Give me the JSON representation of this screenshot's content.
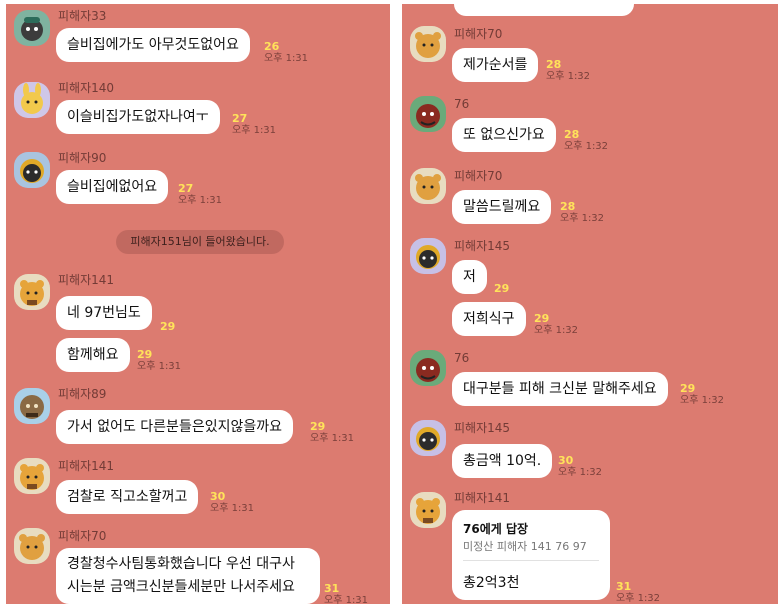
{
  "theme": {
    "chat_bg": "#dc7b70",
    "unread_color": "#ffe35a",
    "bubble_color": "#ffffff"
  },
  "left": {
    "messages": [
      {
        "sender": "피해자33",
        "avatar": "character-avatar-icon",
        "text": "슬비집에가도 아무것도없어요",
        "unread": "26",
        "time": "오후 1:31"
      },
      {
        "sender": "피해자140",
        "avatar": "character-avatar-icon",
        "text": "이슬비집가도없자나여ㅜ",
        "unread": "27",
        "time": "오후 1:31"
      },
      {
        "sender": "피해자90",
        "avatar": "character-avatar-icon",
        "text": "슬비집에없어요",
        "unread": "27",
        "time": "오후 1:31"
      },
      {
        "sender": "피해자141",
        "avatar": "character-avatar-icon",
        "text": "네 97번님도",
        "unread": "29",
        "time": ""
      },
      {
        "sender": "",
        "avatar": "",
        "text": "함께해요",
        "unread": "29",
        "time": "오후 1:31"
      },
      {
        "sender": "피해자89",
        "avatar": "character-avatar-icon",
        "text": "가서 없어도 다른분들은있지않을까요",
        "unread": "29",
        "time": "오후 1:31"
      },
      {
        "sender": "피해자141",
        "avatar": "character-avatar-icon",
        "text": "검찰로 직고소할꺼고",
        "unread": "30",
        "time": "오후 1:31"
      },
      {
        "sender": "피해자70",
        "avatar": "character-avatar-icon",
        "text_line1": "경찰청수사팀통화했습니다 우선 대구사",
        "text_line2": "시는분 금액크신분들세분만 나서주세요",
        "unread": "31",
        "time": "오후 1:31"
      }
    ],
    "system_notice": "피해자151님이 들어왔습니다."
  },
  "right": {
    "messages": [
      {
        "sender": "피해자70",
        "avatar": "character-avatar-icon",
        "text": "제가순서를",
        "unread": "28",
        "time": "오후 1:32"
      },
      {
        "sender": "76",
        "avatar": "character-avatar-icon",
        "text": "또 없으신가요",
        "unread": "28",
        "time": "오후 1:32"
      },
      {
        "sender": "피해자70",
        "avatar": "character-avatar-icon",
        "text": "말씀드릴께요",
        "unread": "28",
        "time": "오후 1:32"
      },
      {
        "sender": "피해자145",
        "avatar": "character-avatar-icon",
        "text": "저",
        "unread": "29",
        "time": ""
      },
      {
        "sender": "",
        "avatar": "",
        "text": "저희식구",
        "unread": "29",
        "time": "오후 1:32"
      },
      {
        "sender": "76",
        "avatar": "character-avatar-icon",
        "text": "대구분들 피해 크신분 말해주세요",
        "unread": "29",
        "time": "오후 1:32"
      },
      {
        "sender": "피해자145",
        "avatar": "character-avatar-icon",
        "text": "총금액 10억.",
        "unread": "30",
        "time": "오후 1:32"
      },
      {
        "sender": "피해자141",
        "avatar": "character-avatar-icon",
        "reply_header": "76에게 답장",
        "reply_quote": "미정산 피해자 141 76 97",
        "text": "총2억3천",
        "unread": "31",
        "time": "오후 1:32"
      }
    ]
  }
}
